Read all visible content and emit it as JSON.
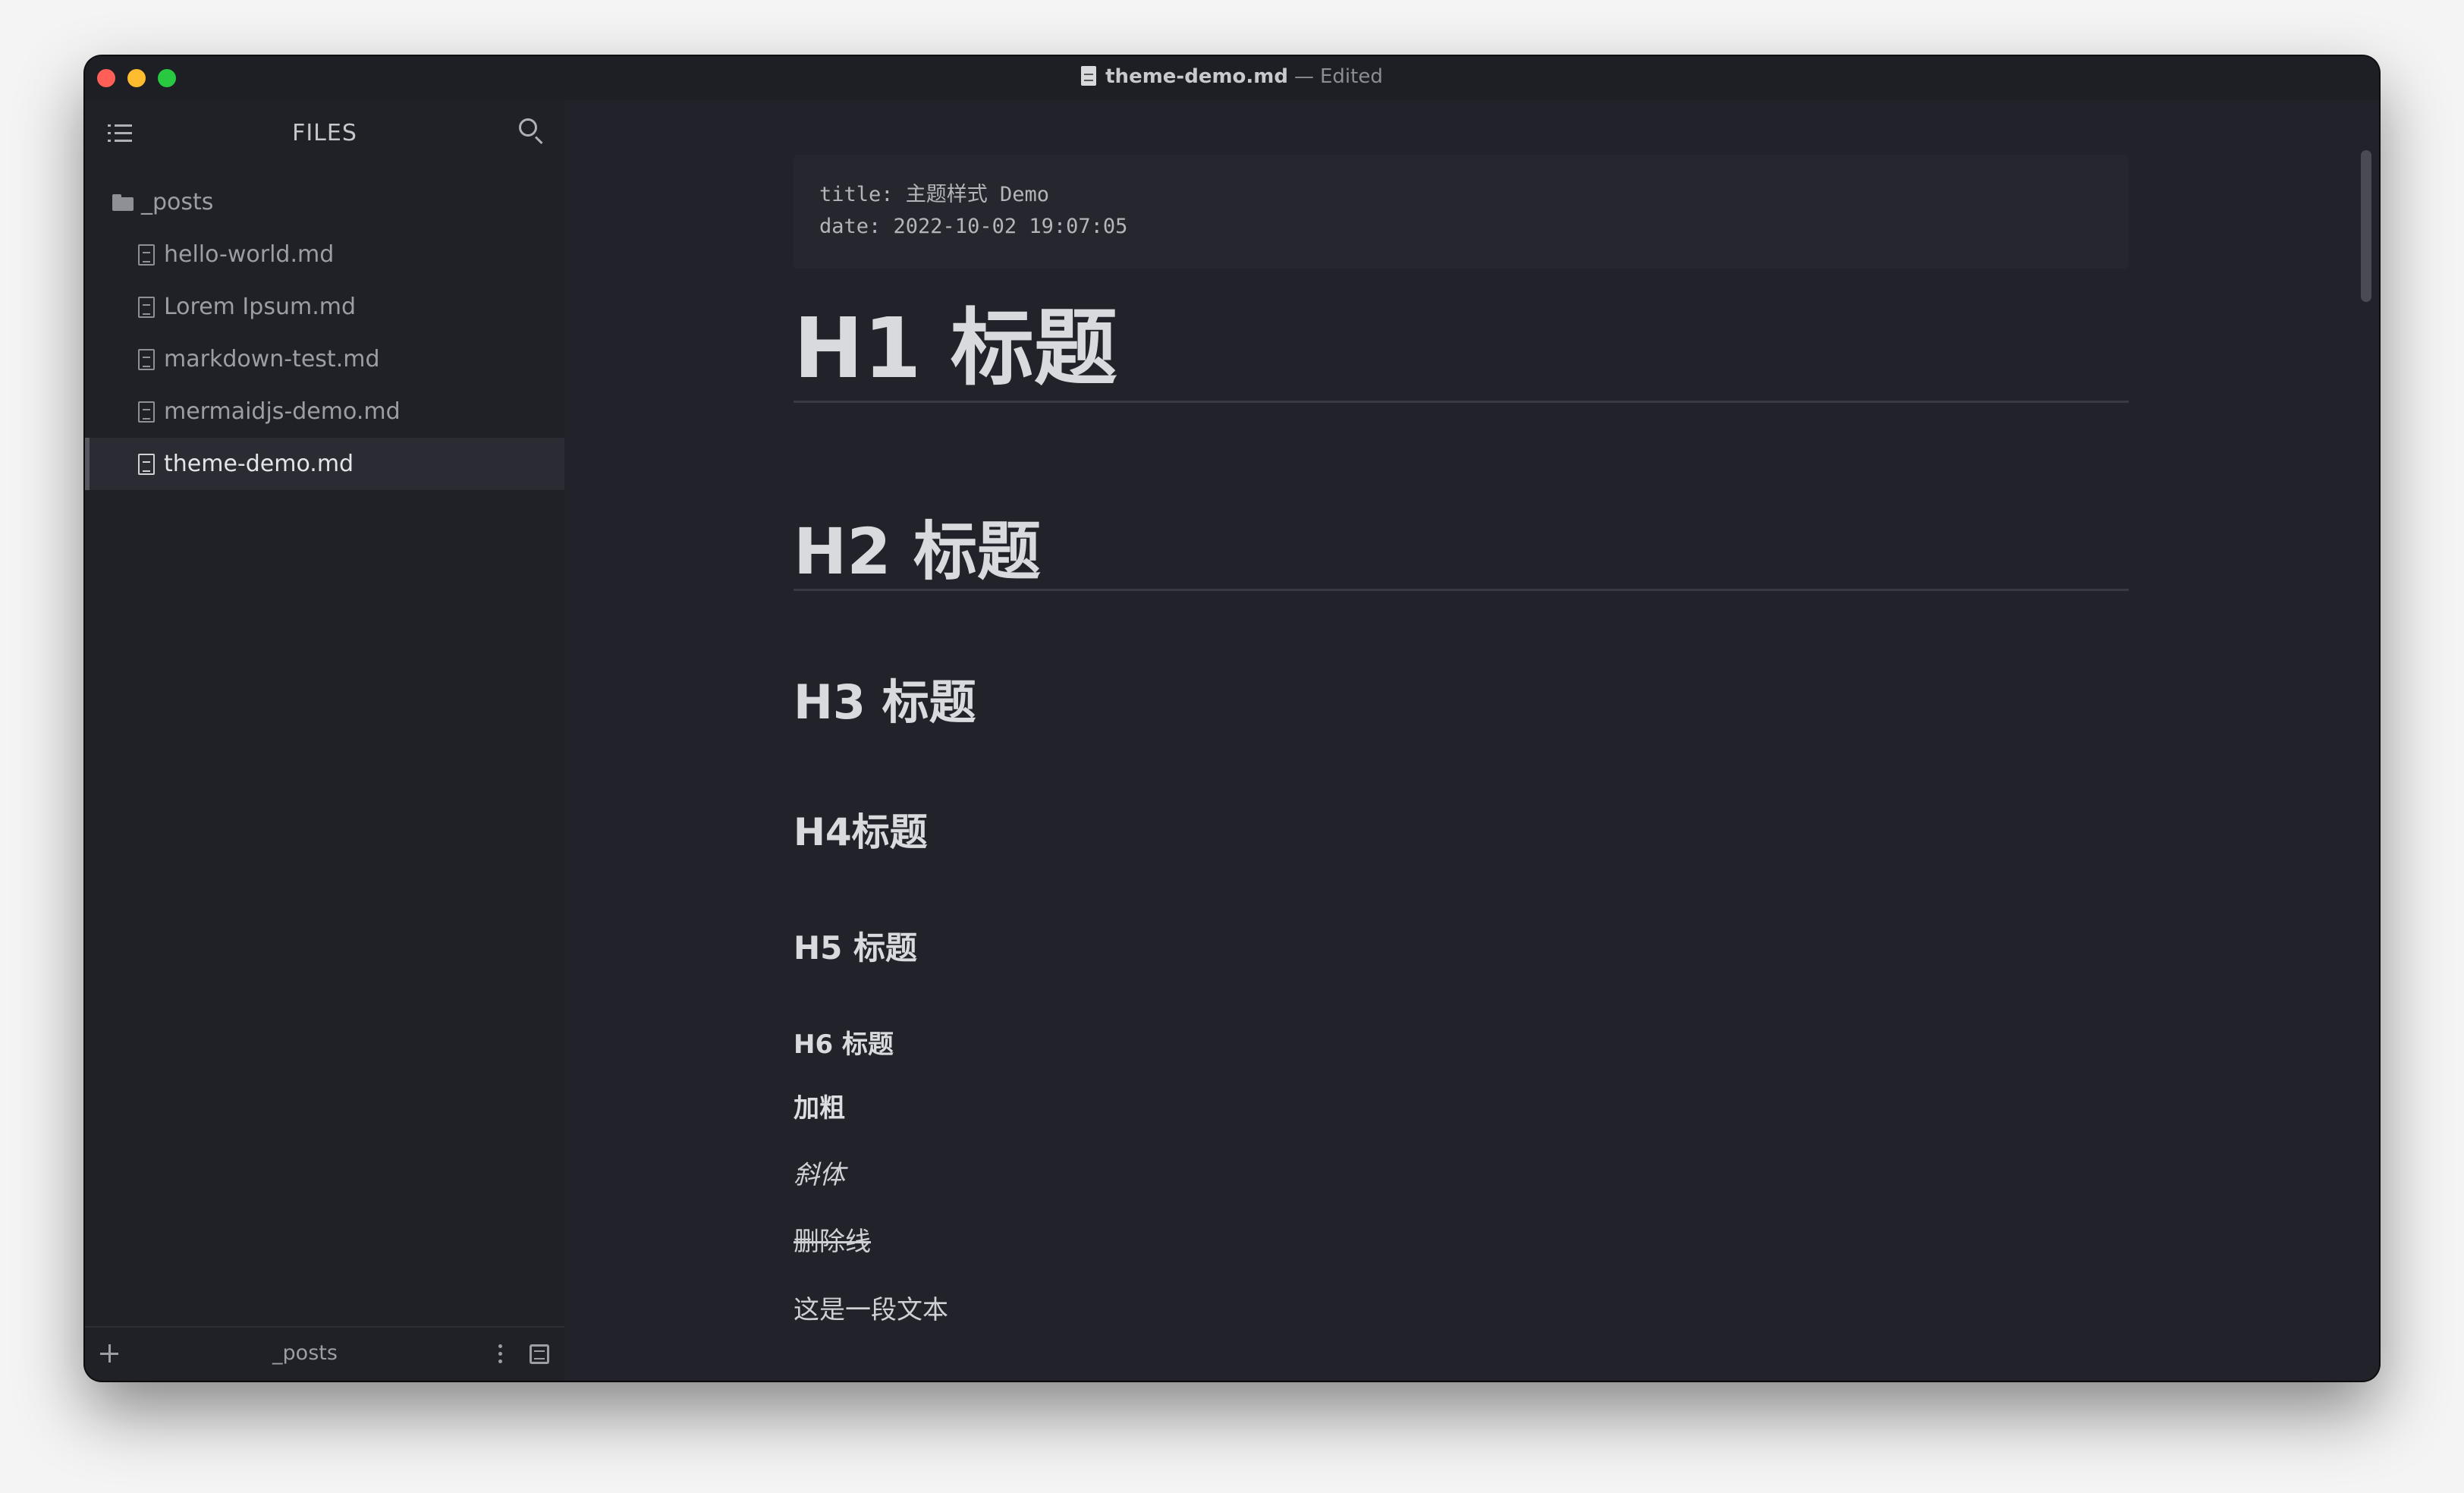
{
  "window": {
    "filename": "theme-demo.md",
    "separator": "—",
    "status": "Edited"
  },
  "icons": {
    "outline": "list-icon",
    "search": "search-icon",
    "folder": "folder-icon",
    "file": "file-icon",
    "add": "plus-icon",
    "more": "more-vertical-icon",
    "panel": "panel-icon"
  },
  "sidebar": {
    "title": "FILES",
    "folder": "_posts",
    "files": [
      {
        "label": "hello-world.md"
      },
      {
        "label": "Lorem Ipsum.md"
      },
      {
        "label": "markdown-test.md"
      },
      {
        "label": "mermaidjs-demo.md"
      },
      {
        "label": "theme-demo.md",
        "active": true
      }
    ],
    "footer_folder": "_posts"
  },
  "document": {
    "frontmatter": "title: 主题样式 Demo\ndate: 2022-10-02 19:07:05",
    "h1": "H1 标题",
    "h2": "H2 标题",
    "h3": "H3 标题",
    "h4": "H4标题",
    "h5": "H5 标题",
    "h6": "H6 标题",
    "bold": "加粗",
    "italic": "斜体",
    "strike": "删除线",
    "paragraph": "这是一段文本"
  },
  "colors": {
    "background": "#22232a",
    "sidebar": "#202126",
    "active_row": "#2b2c33",
    "close": "#ff5f57",
    "minimize": "#febc2e",
    "maximize": "#28c840"
  }
}
